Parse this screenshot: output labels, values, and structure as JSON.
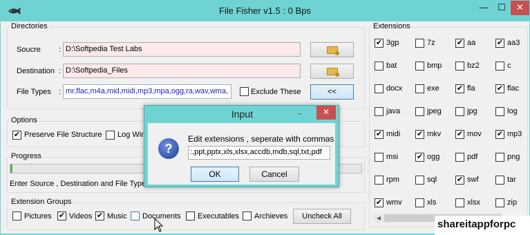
{
  "window": {
    "title": "File Fisher v1.5 : 0 Bps",
    "min": "—",
    "max": "☐",
    "close": "✕"
  },
  "directories": {
    "legend": "Directories",
    "source_label": "Soucre",
    "source_value": "D:\\Softpedia Test Labs",
    "dest_label": "Destination",
    "dest_value": "D:\\Softpedia_Files",
    "filetypes_label": "File Types",
    "filetypes_value": "mr,flac,m4a,mid,midi,mp3,mpa,ogg,ra,wav,wma,",
    "colon": ":",
    "exclude_label": "Exclude These",
    "toggle_btn": "<<"
  },
  "options": {
    "legend": "Options",
    "preserve": "Preserve File Structure",
    "log": "Log Win"
  },
  "progress": {
    "legend": "Progress",
    "status": "Enter Source , Destination and File Type",
    "fraction": 0.006
  },
  "groups": {
    "legend": "Extension Groups",
    "items": [
      {
        "label": "Pictures",
        "checked": false
      },
      {
        "label": "Videos",
        "checked": true
      },
      {
        "label": "Music",
        "checked": true
      },
      {
        "label": "Documents",
        "checked": false
      },
      {
        "label": "Executables",
        "checked": false
      },
      {
        "label": "Archieves",
        "checked": false
      }
    ],
    "uncheck_all": "Uncheck All"
  },
  "extensions": {
    "legend": "Extensions",
    "items": [
      {
        "label": "3gp",
        "checked": true
      },
      {
        "label": "7z",
        "checked": false
      },
      {
        "label": "aa",
        "checked": true
      },
      {
        "label": "aa3",
        "checked": true
      },
      {
        "label": "bat",
        "checked": false
      },
      {
        "label": "bmp",
        "checked": false
      },
      {
        "label": "bz2",
        "checked": false
      },
      {
        "label": "c",
        "checked": false
      },
      {
        "label": "docx",
        "checked": false
      },
      {
        "label": "exe",
        "checked": false
      },
      {
        "label": "fla",
        "checked": true
      },
      {
        "label": "flac",
        "checked": true
      },
      {
        "label": "java",
        "checked": false
      },
      {
        "label": "jpeg",
        "checked": false
      },
      {
        "label": "jpg",
        "checked": false
      },
      {
        "label": "log",
        "checked": false
      },
      {
        "label": "midi",
        "checked": true
      },
      {
        "label": "mkv",
        "checked": true
      },
      {
        "label": "mov",
        "checked": true
      },
      {
        "label": "mp3",
        "checked": true
      },
      {
        "label": "msi",
        "checked": false
      },
      {
        "label": "ogg",
        "checked": true
      },
      {
        "label": "pdf",
        "checked": false
      },
      {
        "label": "png",
        "checked": false
      },
      {
        "label": "rpm",
        "checked": false
      },
      {
        "label": "sql",
        "checked": false
      },
      {
        "label": "swf",
        "checked": true
      },
      {
        "label": "tar",
        "checked": false
      },
      {
        "label": "wmv",
        "checked": true
      },
      {
        "label": "xls",
        "checked": false
      },
      {
        "label": "xlsx",
        "checked": false
      },
      {
        "label": "zip",
        "checked": false
      }
    ]
  },
  "dialog": {
    "title": "Input",
    "close": "✕",
    "prompt": "Edit extensions , seperate with commas",
    "value": ":,ppt,pptx,xls,xlsx,accdb,mdb,sql,txt,pdf",
    "ok": "OK",
    "cancel": "Cancel",
    "icon": "?"
  },
  "watermark": "shareitappforpc",
  "checkmark": "✔"
}
